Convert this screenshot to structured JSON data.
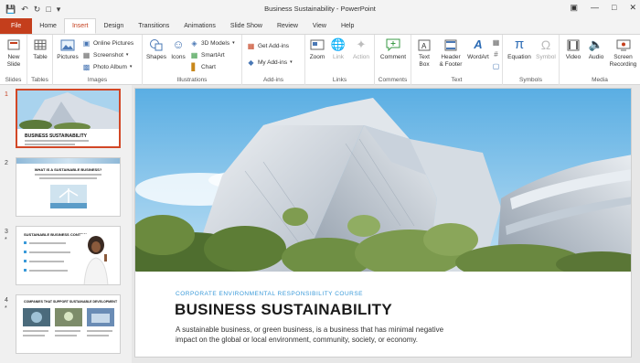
{
  "window": {
    "title": "Business Sustainability  -  PowerPoint"
  },
  "tabs": [
    "File",
    "Home",
    "Insert",
    "Design",
    "Transitions",
    "Animations",
    "Slide Show",
    "Review",
    "View",
    "Help"
  ],
  "ribbon": {
    "slides": {
      "new_slide": "New\nSlide",
      "group": "Slides"
    },
    "tables": {
      "table": "Table",
      "group": "Tables"
    },
    "images": {
      "pictures": "Pictures",
      "online_pictures": "Online Pictures",
      "screenshot": "Screenshot",
      "photo_album": "Photo Album",
      "group": "Images"
    },
    "illustrations": {
      "shapes": "Shapes",
      "icons": "Icons",
      "models": "3D Models",
      "smartart": "SmartArt",
      "chart": "Chart",
      "group": "Illustrations"
    },
    "addins": {
      "get": "Get Add-ins",
      "my": "My Add-ins",
      "group": "Add-ins"
    },
    "links": {
      "zoom": "Zoom",
      "link": "Link",
      "action": "Action",
      "group": "Links"
    },
    "comments": {
      "comment": "Comment",
      "group": "Comments"
    },
    "text": {
      "textbox": "Text\nBox",
      "headerfooter": "Header\n& Footer",
      "wordart": "WordArt",
      "group": "Text"
    },
    "symbols": {
      "equation": "Equation",
      "symbol": "Symbol",
      "group": "Symbols"
    },
    "media": {
      "video": "Video",
      "audio": "Audio",
      "screen": "Screen\nRecording",
      "group": "Media"
    }
  },
  "thumbnails": [
    {
      "num": "1",
      "star": "",
      "title": "BUSINESS SUSTAINABILITY"
    },
    {
      "num": "2",
      "star": "",
      "title": "WHAT IS A SUSTAINABLE BUSINESS?"
    },
    {
      "num": "3",
      "star": "*",
      "title": "SUSTAINABLE BUSINESS CONTROL"
    },
    {
      "num": "4",
      "star": "*",
      "title": "COMPANIES THAT SUPPORT SUSTAINABLE DEVELOPMENT"
    }
  ],
  "slide": {
    "kicker": "CORPORATE ENVIRONMENTAL RESPONSIBILITY COURSE",
    "headline": "BUSINESS SUSTAINABILITY",
    "body": "A sustainable business, or green business, is a business that has minimal negative impact on the global or local environment, community, society, or economy."
  },
  "colors": {
    "accent": "#c43e1c",
    "selection": "#d24726",
    "kicker": "#3a9ad9"
  }
}
